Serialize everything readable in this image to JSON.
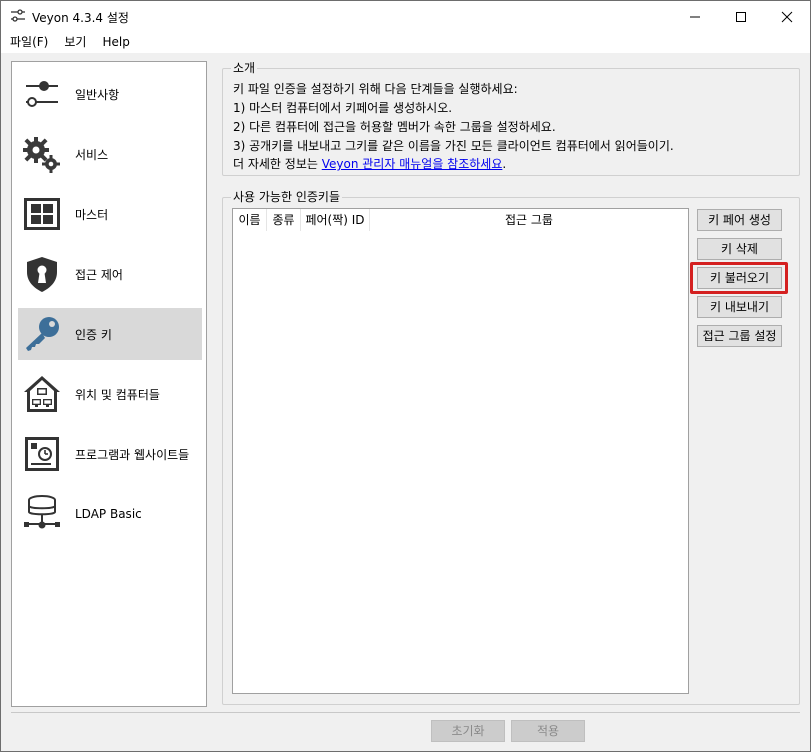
{
  "window": {
    "title": "Veyon  4.3.4 설정",
    "icon": "sliders-icon"
  },
  "menubar": {
    "items": [
      "파일(F)",
      "보기",
      "Help"
    ]
  },
  "sidebar": {
    "items": [
      {
        "label": "일반사항",
        "icon": "general-sliders-icon"
      },
      {
        "label": "서비스",
        "icon": "gears-icon"
      },
      {
        "label": "마스터",
        "icon": "master-grid-icon"
      },
      {
        "label": "접근 제어",
        "icon": "shield-keyhole-icon"
      },
      {
        "label": "인증 키",
        "icon": "key-icon",
        "active": true
      },
      {
        "label": "위치 및 컴퓨터들",
        "icon": "house-computers-icon"
      },
      {
        "label": "프로그램과 웹사이트들",
        "icon": "programs-websites-icon"
      },
      {
        "label": "LDAP Basic",
        "icon": "database-network-icon"
      }
    ]
  },
  "intro": {
    "title": "소개",
    "lines": [
      "키 파일 인증을 설정하기 위해 다음 단계들을 실행하세요:",
      "1) 마스터 컴퓨터에서 키페어를 생성하시오.",
      "2) 다른 컴퓨터에 접근을 허용할 멤버가 속한 그룹을 설정하세요.",
      "3) 공개키를 내보내고 그키를 같은 이름을 가진 모든 클라이언트 컴퓨터에서 읽어들이기."
    ],
    "more_prefix": "더 자세한 정보는 ",
    "more_link": "Veyon 관리자 매뉴얼을 참조하세요",
    "more_suffix": "."
  },
  "keys": {
    "title": "사용 가능한 인증키들",
    "columns": [
      "이름",
      "종류",
      "페어(짝) ID",
      "접근 그룹"
    ],
    "rows": []
  },
  "actions": {
    "create_pair": "키 페어 생성",
    "delete": "키 삭제",
    "import": "키 불러오기",
    "export": "키 내보내기",
    "set_group": "접근 그룹 설정"
  },
  "footer": {
    "reset": "초기화",
    "apply": "적용"
  },
  "colors": {
    "highlight": "#d42020",
    "link": "#0000ee",
    "active_item": "#d9d9d9"
  }
}
